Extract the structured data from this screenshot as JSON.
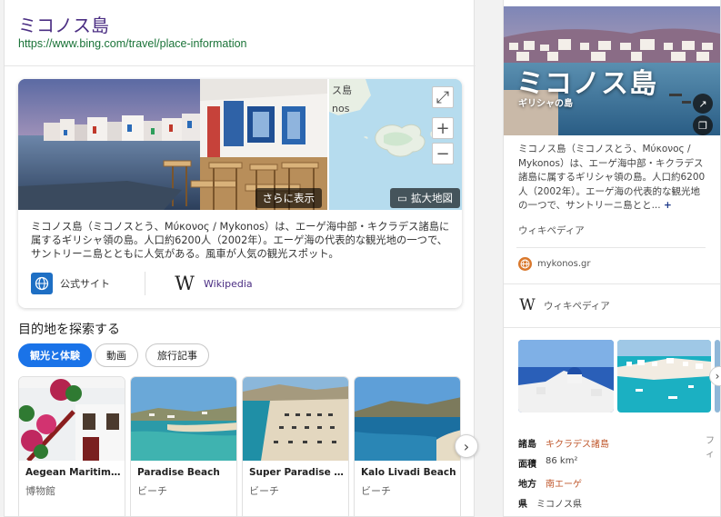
{
  "result": {
    "title": "ミコノス島",
    "url": "https://www.bing.com/travel/place-information"
  },
  "hero": {
    "more_photos": "さらに表示",
    "big_map": "拡大地図",
    "map_labels": [
      "ス島",
      "nos"
    ],
    "description": "ミコノス島（ミコノスとう、Μύκονος / Mykonos）は、エーゲ海中部・キクラデス諸島に属するギリシャ領の島。人口約6200人（2002年）。エーゲ海の代表的な観光地の一つで、サントリーニ島とともに人気がある。風車が人気の観光スポット。",
    "official_site": "公式サイト",
    "wikipedia": "Wikipedia"
  },
  "explore": {
    "title": "目的地を探索する",
    "chips": [
      "観光と体験",
      "動画",
      "旅行記事"
    ],
    "destinations": [
      {
        "name": "Aegean Maritime ...",
        "category": "博物館"
      },
      {
        "name": "Paradise Beach",
        "category": "ビーチ"
      },
      {
        "name": "Super Paradise Be...",
        "category": "ビーチ"
      },
      {
        "name": "Kalo Livadi Beach",
        "category": "ビーチ"
      }
    ],
    "next_icon": "chevron-right-icon"
  },
  "side": {
    "title": "ミコノス島",
    "subtitle": "ギリシャの島",
    "description": "ミコノス島（ミコノスとう、Μύκονος / Mykonos）は、エーゲ海中部・キクラデス諸島に属するギリシャ領の島。人口約6200人（2002年）。エーゲ海の代表的な観光地の一つで、サントリーニ島とと...",
    "more": "+",
    "wiki_source": "ウィキペディア",
    "website": "mykonos.gr",
    "wiki_row": "ウィキペディア",
    "facts": [
      {
        "key": "諸島",
        "value": "キクラデス諸島",
        "link": true
      },
      {
        "key": "面積",
        "value": "86 km²",
        "link": false
      },
      {
        "key": "地方",
        "value": "南エーゲ",
        "link": true
      },
      {
        "key": "県",
        "value": "ミコノス県",
        "link": false
      }
    ],
    "facts_trail": "フィ"
  },
  "colors": {
    "title": "#4b2e83",
    "url": "#1a7338",
    "chip_active": "#1a73e8",
    "fact_link": "#c0592e"
  }
}
